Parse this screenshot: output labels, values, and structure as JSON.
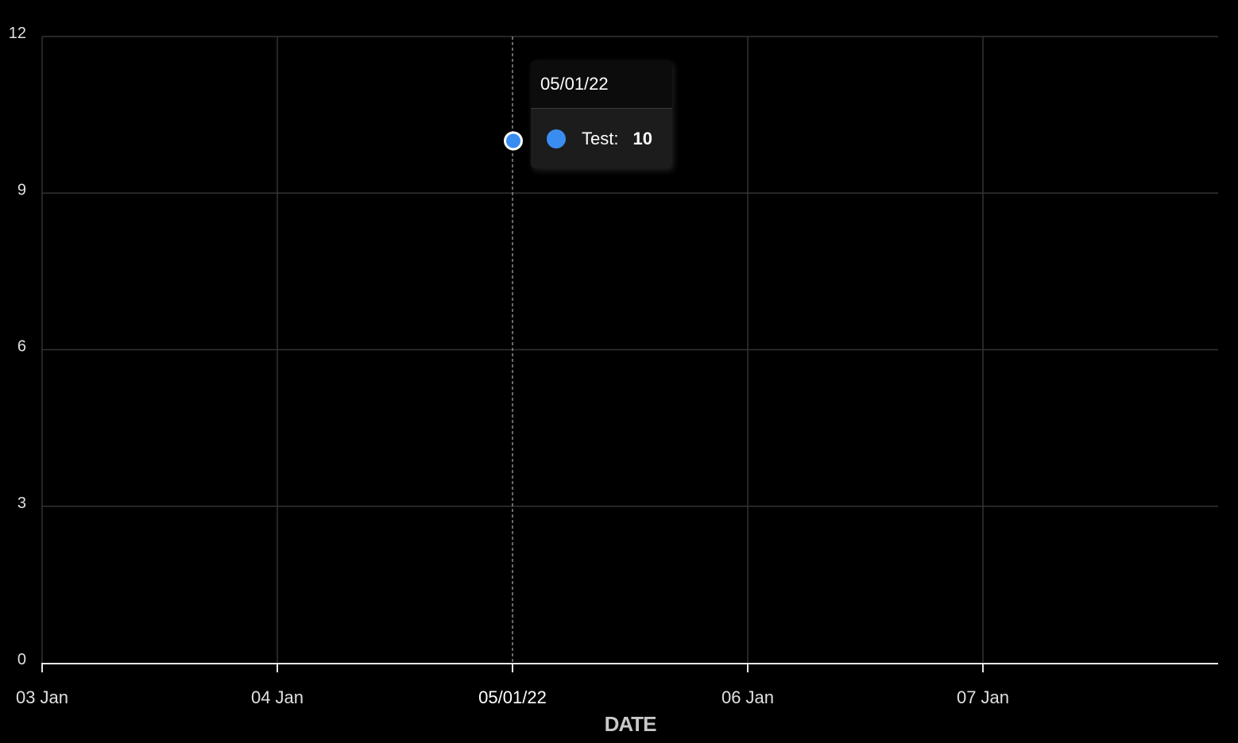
{
  "chart_data": {
    "type": "line",
    "x": [
      "03 Jan",
      "04 Jan",
      "05 Jan",
      "06 Jan",
      "07 Jan"
    ],
    "x_ticks": [
      "03 Jan",
      "04 Jan",
      "05/01/22",
      "06 Jan",
      "07 Jan"
    ],
    "xlabel": "DATE",
    "ylabel": "",
    "ylim": [
      0,
      12
    ],
    "y_ticks": [
      "0",
      "3",
      "6",
      "9",
      "12"
    ],
    "grid": true,
    "series": [
      {
        "name": "Test",
        "color": "#3a8df0",
        "points": [
          {
            "x": "05 Jan",
            "y": 10
          }
        ]
      }
    ],
    "active_index": 2,
    "tooltip": {
      "title": "05/01/22",
      "series_label": "Test:",
      "value": "10"
    }
  },
  "colors": {
    "background": "#000000",
    "grid": "#333333",
    "axis": "#e6e6e6",
    "series": "#3a8df0"
  }
}
